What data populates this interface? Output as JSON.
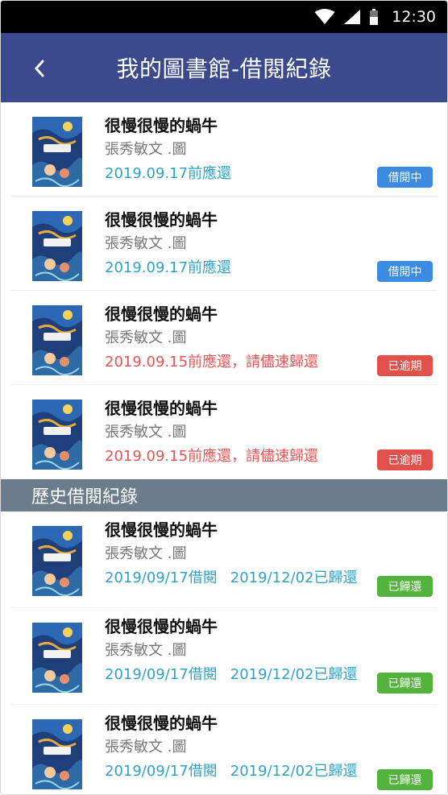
{
  "status_bar": {
    "time": "12:30",
    "icons": [
      "wifi-icon",
      "cell-signal-icon",
      "battery-icon"
    ]
  },
  "app_bar": {
    "title": "我的圖書館-借閱紀錄",
    "back_icon": "chevron-left-icon"
  },
  "colors": {
    "app_bar": "#3a4a8c",
    "due_ok": "#2fa3c6",
    "due_late": "#e85454",
    "badge_borrowing": "#3d8be0",
    "badge_overdue": "#e1504b",
    "badge_returned": "#53b33d",
    "section_header": "#6b7c8d"
  },
  "current_loans": [
    {
      "title": "很慢很慢的蝸牛",
      "author": "張秀敏文 .圖",
      "due_text": "2019.09.17前應還",
      "status": "ok",
      "badge": "借閱中"
    },
    {
      "title": "很慢很慢的蝸牛",
      "author": "張秀敏文 .圖",
      "due_text": "2019.09.17前應還",
      "status": "ok",
      "badge": "借閱中"
    },
    {
      "title": "很慢很慢的蝸牛",
      "author": "張秀敏文 .圖",
      "due_text": "2019.09.15前應還，請儘速歸還",
      "status": "late",
      "badge": "已逾期"
    },
    {
      "title": "很慢很慢的蝸牛",
      "author": "張秀敏文 .圖",
      "due_text": "2019.09.15前應還，請儘速歸還",
      "status": "late",
      "badge": "已逾期"
    }
  ],
  "history": {
    "header": "歷史借閱紀錄",
    "items": [
      {
        "title": "很慢很慢的蝸牛",
        "author": "張秀敏文 .圖",
        "borrowed": "2019/09/17借閱",
        "returned": "2019/12/02已歸還",
        "badge": "已歸還"
      },
      {
        "title": "很慢很慢的蝸牛",
        "author": "張秀敏文 .圖",
        "borrowed": "2019/09/17借閱",
        "returned": "2019/12/02已歸還",
        "badge": "已歸還"
      },
      {
        "title": "很慢很慢的蝸牛",
        "author": "張秀敏文 .圖",
        "borrowed": "2019/09/17借閱",
        "returned": "2019/12/02已歸還",
        "badge": "已歸還"
      }
    ]
  }
}
